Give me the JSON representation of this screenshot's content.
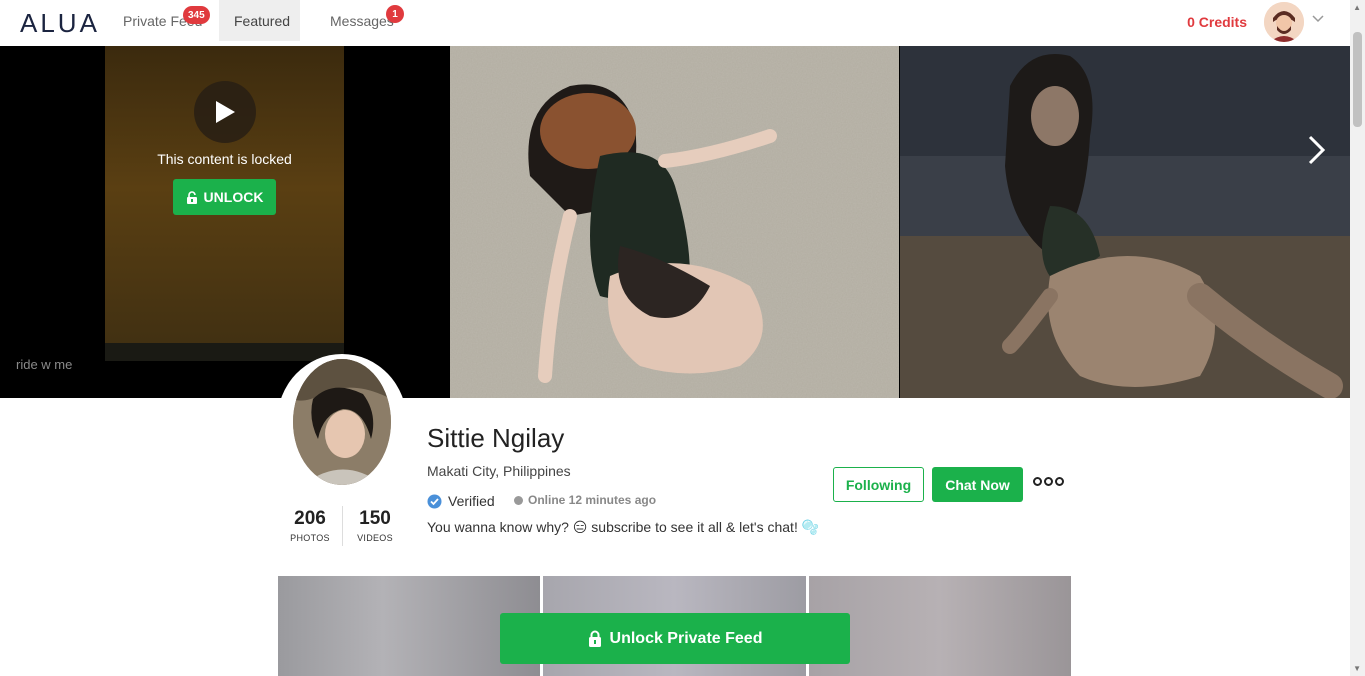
{
  "nav": {
    "logo": "ALUA",
    "tabs": [
      {
        "label": "Private Feed",
        "badge": "345"
      },
      {
        "label": "Featured"
      },
      {
        "label": "Messages",
        "badge": "1"
      }
    ],
    "credits": "0 Credits"
  },
  "gallery": {
    "locked_text": "This content is locked",
    "unlock_label": "UNLOCK",
    "caption": "ride w me"
  },
  "profile": {
    "name": "Sittie Ngilay",
    "location": "Makati City, Philippines",
    "verified_label": "Verified",
    "online_status": "Online 12 minutes ago",
    "bio": "You wanna know why? 😑 subscribe to see it all & let's chat! 🫧",
    "stats": [
      {
        "value": "206",
        "label": "PHOTOS"
      },
      {
        "value": "150",
        "label": "VIDEOS"
      }
    ],
    "following_label": "Following",
    "chat_label": "Chat Now"
  },
  "feed": {
    "unlock_label": "Unlock Private Feed"
  },
  "colors": {
    "accent_green": "#1bb14b",
    "badge_red": "#e03a3e",
    "logo_navy": "#1b2440"
  }
}
